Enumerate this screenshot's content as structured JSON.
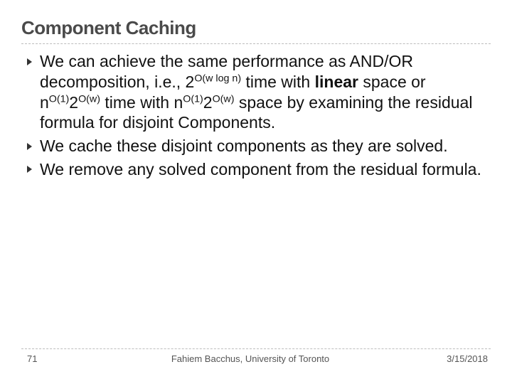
{
  "title": "Component Caching",
  "bullets": {
    "b1": {
      "p1": "We can achieve the same performance as AND/OR decomposition, i.e., 2",
      "exp1": "O(w log n)",
      "p2": " time with ",
      "linear": "linear",
      "p3": " space or n",
      "exp2": "O(1)",
      "p4": "2",
      "exp3": "O(w)",
      "p5": " time with n",
      "exp4": "O(1)",
      "p6": "2",
      "exp5": "O(w)",
      "p7": " space by examining  the residual formula for disjoint Components."
    },
    "b2": "We cache these disjoint components as they are solved.",
    "b3": "We remove any solved component from the residual formula."
  },
  "footer": {
    "page": "71",
    "center": "Fahiem Bacchus, University of Toronto",
    "date": "3/15/2018"
  }
}
